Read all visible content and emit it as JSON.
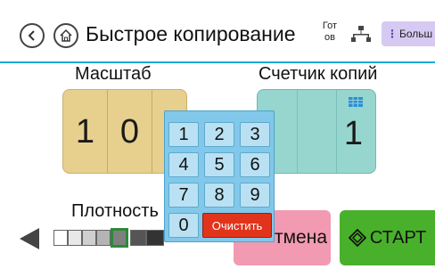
{
  "header": {
    "title": "Быстрое копирование",
    "status_line1": "Гот",
    "status_line2": "ов",
    "more_label": "Больш"
  },
  "scale": {
    "label": "Масштаб",
    "digits": [
      "1",
      "0",
      "("
    ]
  },
  "copies": {
    "label": "Счетчик копий",
    "value": "1"
  },
  "density": {
    "label": "Плотность",
    "level": 4,
    "steps": 7
  },
  "keypad": {
    "keys": [
      "1",
      "2",
      "3",
      "4",
      "5",
      "6",
      "7",
      "8",
      "9",
      "0"
    ],
    "clear_label": "Очистить"
  },
  "buttons": {
    "cancel_label": "тмена",
    "start_label": "СТАРТ"
  },
  "colors": {
    "scale_bg": "#e7cf8e",
    "copies_bg": "#96d6cf",
    "cancel_bg": "#f29ab1",
    "start_bg": "#49b02b",
    "keypad_bg": "#82c8ea",
    "clear_bg": "#e1341b"
  }
}
